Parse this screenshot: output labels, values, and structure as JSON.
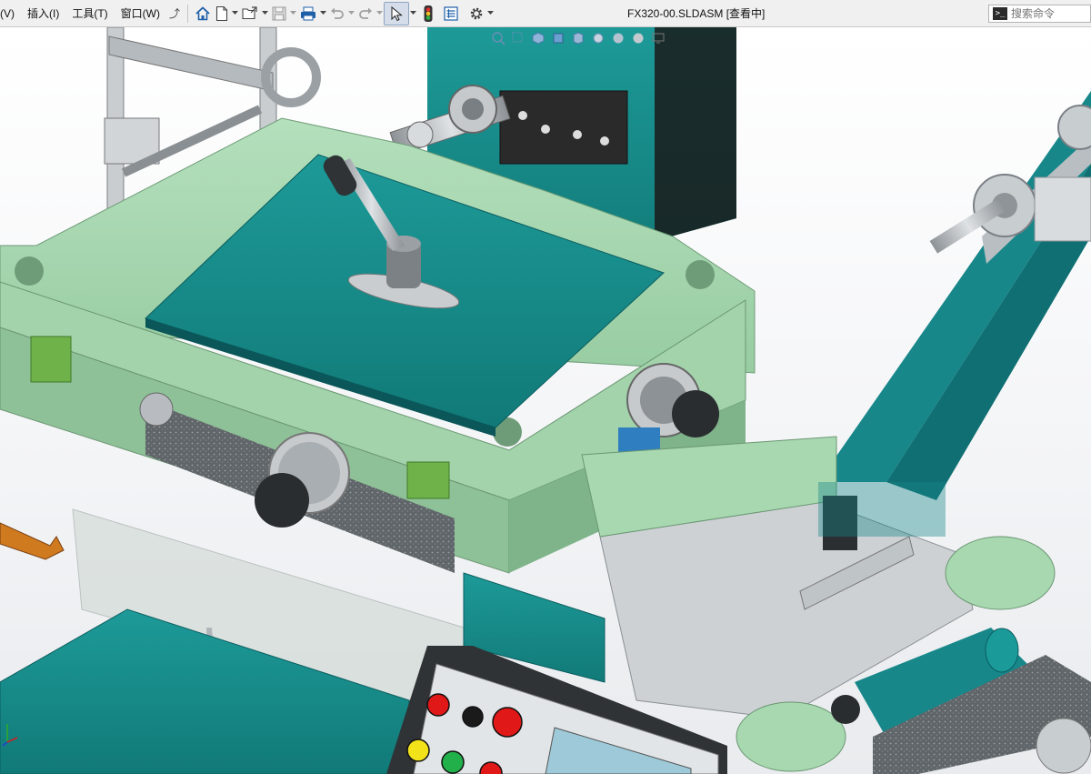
{
  "menu": [
    {
      "label": "(V)",
      "key": "view"
    },
    {
      "label": "插入(I)",
      "key": "insert"
    },
    {
      "label": "工具(T)",
      "key": "tools"
    },
    {
      "label": "窗口(W)",
      "key": "window"
    }
  ],
  "toolbar": {
    "icons": [
      "home-icon",
      "new-document-icon",
      "open-folder-icon",
      "save-icon",
      "print-icon",
      "undo-icon",
      "redo-icon",
      "select-cursor-icon",
      "traffic-light-icon",
      "file-properties-icon",
      "options-gear-icon"
    ]
  },
  "document": {
    "title": "FX320-00.SLDASM [查看中]"
  },
  "search": {
    "placeholder": "搜索命令",
    "value": ""
  },
  "colors": {
    "teal": "#1a8f8f",
    "teal_dark": "#0d6b6b",
    "mint": "#a8d8b0",
    "mint_dark": "#7fb48a",
    "steel": "#bfc3c7",
    "background": "#ffffff"
  },
  "control_panel": {
    "buttons": [
      {
        "color": "#e01818"
      },
      {
        "color": "#1a1a1a"
      },
      {
        "color": "#e01818"
      },
      {
        "color": "#f2e21a"
      },
      {
        "color": "#22b04a"
      },
      {
        "color": "#e01818"
      }
    ]
  }
}
